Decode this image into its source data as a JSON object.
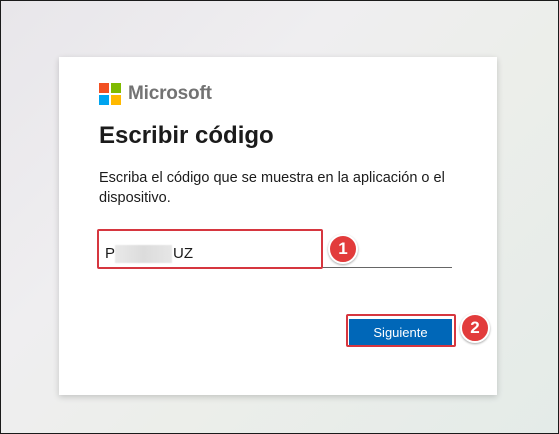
{
  "brand": {
    "name": "Microsoft",
    "logo_colors": [
      "#f25022",
      "#7fba00",
      "#00a4ef",
      "#ffb900"
    ]
  },
  "page": {
    "title": "Escribir código",
    "description": "Escriba el código que se muestra en la aplicación o el dispositivo."
  },
  "code_field": {
    "value_start": "P",
    "value_end": "UZ"
  },
  "actions": {
    "next_label": "Siguiente",
    "accent_color": "#0067b8"
  },
  "annotations": {
    "step1": "1",
    "step2": "2",
    "color": "#e23b3b"
  }
}
